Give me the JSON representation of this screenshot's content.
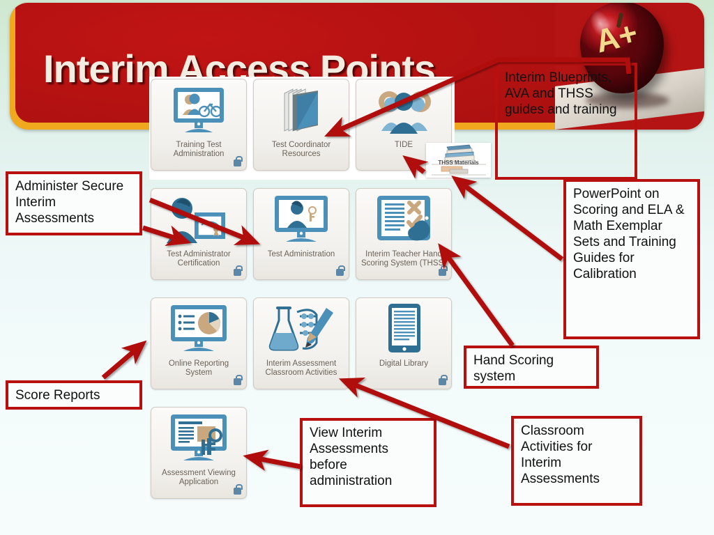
{
  "header": {
    "title": "Interim Access Points",
    "apple_grade": "A+"
  },
  "tiles": [
    {
      "label": "Training Test\nAdministration",
      "icon": "monitor-student-bike-icon",
      "locked": true
    },
    {
      "label": "Test Coordinator\nResources",
      "icon": "books-stack-icon",
      "locked": false
    },
    {
      "label": "TIDE",
      "icon": "people-gears-icon",
      "locked": false
    },
    {
      "label": "Test Administrator\nCertification",
      "icon": "person-certificate-icon",
      "locked": true
    },
    {
      "label": "Test Administration",
      "icon": "monitor-person-keys-icon",
      "locked": true
    },
    {
      "label": "Interim Teacher Hand\nScoring System (THSS)",
      "icon": "tablet-hand-scoring-icon",
      "locked": true
    },
    {
      "label": "Online Reporting\nSystem",
      "icon": "monitor-pie-chart-icon",
      "locked": true
    },
    {
      "label": "Interim Assessment\nClassroom Activities",
      "icon": "flask-abacus-pencil-icon",
      "locked": false
    },
    {
      "label": "Digital Library",
      "icon": "tablet-document-icon",
      "locked": true
    },
    {
      "label": "Assessment Viewing\nApplication",
      "icon": "monitor-document-keys-icon",
      "locked": true
    }
  ],
  "popup": {
    "label": "THSS Materials",
    "icon": "books-stack-icon"
  },
  "callouts": [
    {
      "id": "interim-blueprints",
      "text": "Interim Blueprints, AVA and THSS guides and training"
    },
    {
      "id": "powerpoint-scoring",
      "text": "PowerPoint on Scoring and ELA & Math Exemplar Sets and Training Guides for Calibration"
    },
    {
      "id": "hand-scoring",
      "text": "Hand Scoring system"
    },
    {
      "id": "classroom-activities",
      "text": "Classroom Activities for Interim Assessments"
    },
    {
      "id": "administer-secure",
      "text": "Administer Secure Interim Assessments"
    },
    {
      "id": "score-reports",
      "text": "Score Reports"
    },
    {
      "id": "view-interim",
      "text": "View Interim Assessments before administration"
    }
  ],
  "colors": {
    "banner_red": "#b01111",
    "banner_border_gold": "#f0a81e",
    "callout_border": "#b80f0f",
    "arrow_red": "#b01010",
    "tile_icon_blue": "#4a90b9",
    "tile_icon_tan": "#c9a77f"
  }
}
